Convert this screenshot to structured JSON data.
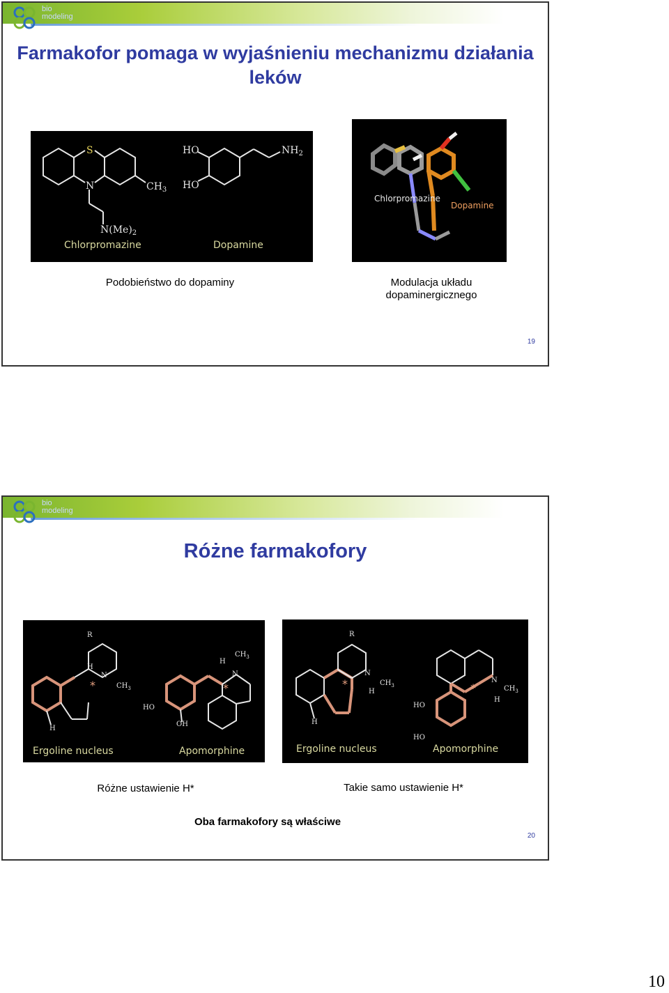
{
  "slides": [
    {
      "title": "Farmakofor pomaga w wyjaśnieniu mechanizmu działania leków",
      "logo_text": [
        "bio",
        "modeling"
      ],
      "panel_left": {
        "atoms": [
          "S",
          "HO",
          "NH",
          "2",
          "N",
          "CH",
          "3",
          "HO",
          "N(Me)",
          "2"
        ],
        "labels": [
          "Chlorpromazine",
          "Dopamine"
        ]
      },
      "panel_right": {
        "labels": [
          "Chlorpromazine",
          "Dopamine"
        ]
      },
      "captions": [
        "Podobieństwo do dopaminy",
        "Modulacja układu",
        "dopaminergicznego"
      ],
      "page_number": "19"
    },
    {
      "title": "Różne farmakofory",
      "logo_text": [
        "bio",
        "modeling"
      ],
      "panel_left": {
        "labels": [
          "Ergoline nucleus",
          "Apomorphine"
        ]
      },
      "panel_right": {
        "labels": [
          "Ergoline nucleus",
          "Apomorphine"
        ]
      },
      "atoms": [
        "R",
        "H",
        "N",
        "CH",
        "3",
        "HO",
        "OH",
        "*"
      ],
      "captions": [
        "Różne ustawienie H*",
        "Takie samo ustawienie H*",
        "Oba farmakofory są właściwe"
      ],
      "page_number": "20"
    }
  ],
  "footer_page": "10"
}
